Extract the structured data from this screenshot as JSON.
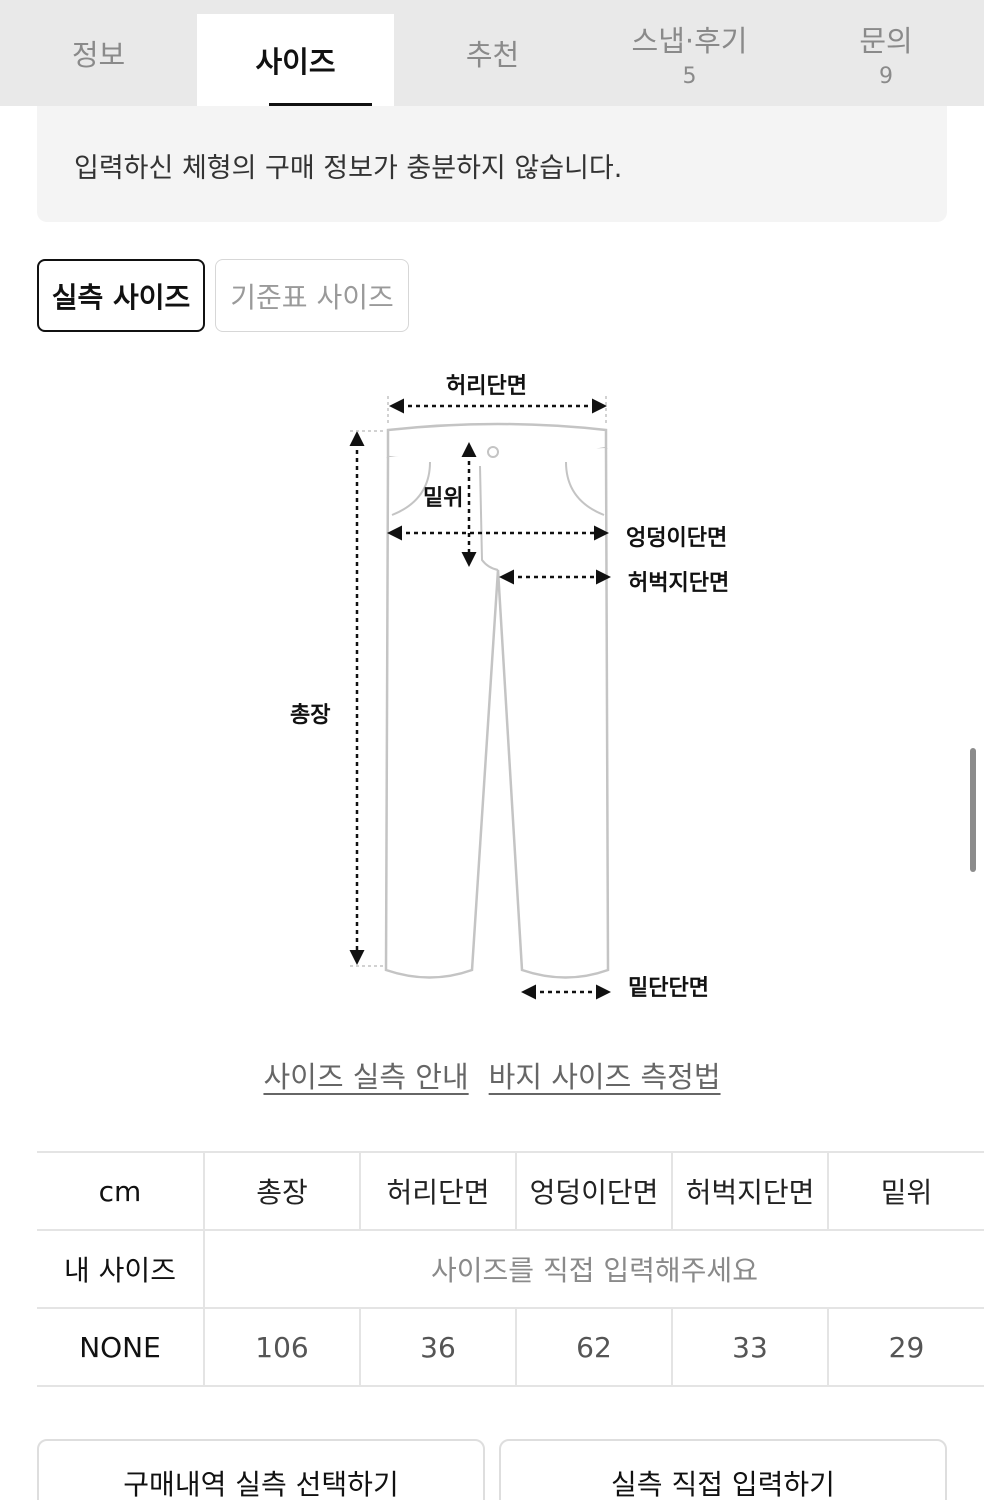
{
  "tabs": [
    {
      "label": "정보",
      "count": ""
    },
    {
      "label": "사이즈",
      "count": ""
    },
    {
      "label": "추천",
      "count": ""
    },
    {
      "label": "스냅·후기",
      "count": "5"
    },
    {
      "label": "문의",
      "count": "9"
    }
  ],
  "notice": {
    "text": "입력하신 체형의 구매 정보가 충분하지 않습니다."
  },
  "size_type": {
    "actual": "실측 사이즈",
    "standard": "기준표 사이즈"
  },
  "diagram_labels": {
    "waist": "허리단면",
    "rise": "밑위",
    "hip": "엉덩이단면",
    "thigh": "허벅지단면",
    "length": "총장",
    "hem": "밑단단면"
  },
  "links": {
    "guide": "사이즈 실측 안내",
    "howto": "바지 사이즈 측정법"
  },
  "table": {
    "headers": [
      "cm",
      "총장",
      "허리단면",
      "엉덩이단면",
      "허벅지단면",
      "밑위"
    ],
    "my_size_label": "내 사이즈",
    "my_size_hint": "사이즈를 직접 입력해주세요",
    "rows": [
      {
        "name": "NONE",
        "values": [
          "106",
          "36",
          "62",
          "33",
          "29"
        ]
      }
    ]
  },
  "buttons": {
    "purchase": "구매내역 실측 선택하기",
    "manual": "실측 직접 입력하기"
  }
}
